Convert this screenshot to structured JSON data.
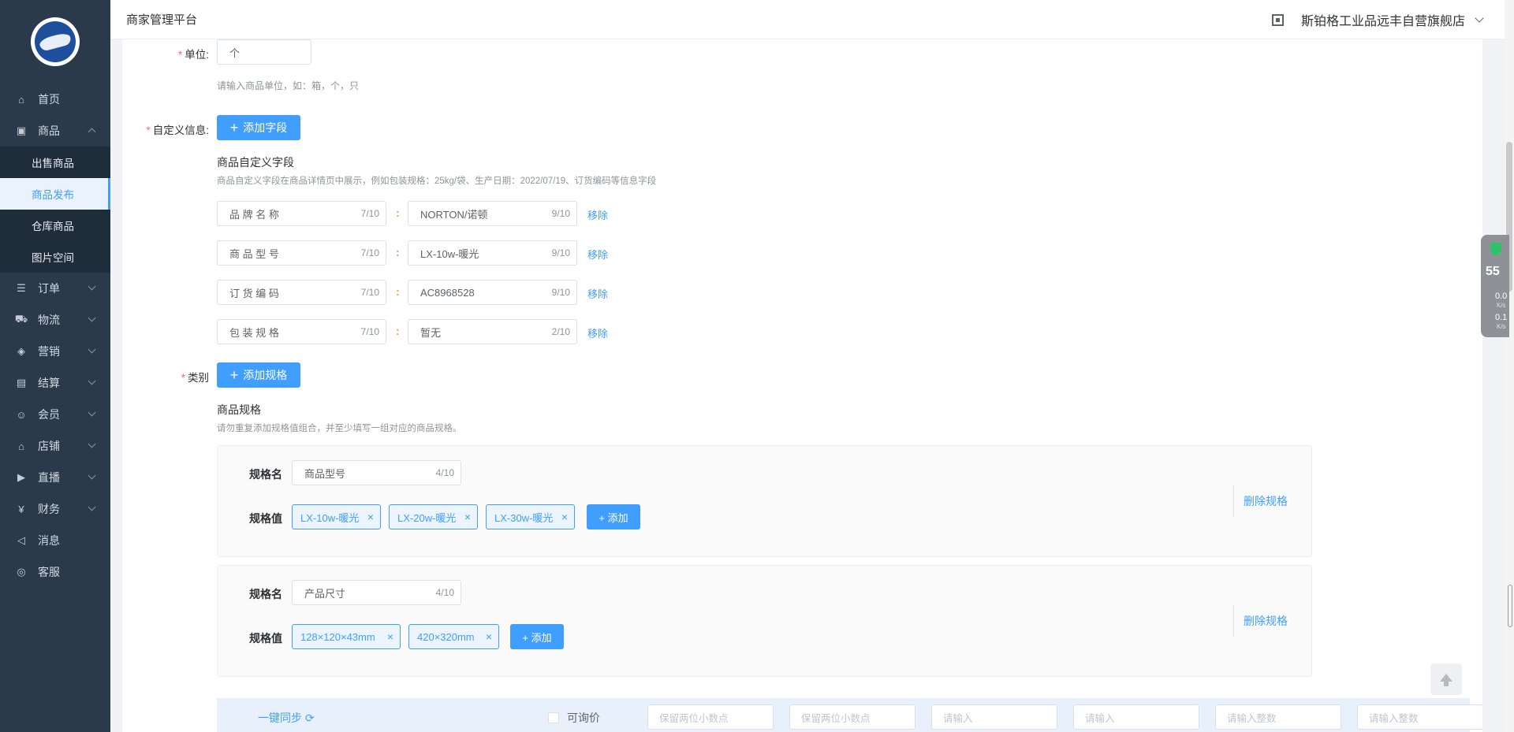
{
  "app": {
    "title": "商家管理平台",
    "shop_name": "斯铂格工业品远丰自营旗舰店"
  },
  "sidebar": {
    "items": [
      {
        "label": "首页",
        "icon": "home-icon"
      },
      {
        "label": "商品",
        "icon": "goods-icon",
        "expanded": true
      },
      {
        "label": "订单",
        "icon": "order-icon"
      },
      {
        "label": "物流",
        "icon": "truck-icon"
      },
      {
        "label": "营销",
        "icon": "tag-icon"
      },
      {
        "label": "结算",
        "icon": "ledger-icon"
      },
      {
        "label": "会员",
        "icon": "user-icon"
      },
      {
        "label": "店铺",
        "icon": "store-icon"
      },
      {
        "label": "直播",
        "icon": "live-icon"
      },
      {
        "label": "财务",
        "icon": "finance-icon"
      },
      {
        "label": "消息",
        "icon": "speaker-icon"
      },
      {
        "label": "客服",
        "icon": "service-icon"
      }
    ],
    "sub_items": [
      {
        "label": "出售商品"
      },
      {
        "label": "商品发布",
        "active": true
      },
      {
        "label": "仓库商品"
      },
      {
        "label": "图片空间"
      }
    ]
  },
  "form": {
    "unit": {
      "label": "单位:",
      "value": "个",
      "hint": "请输入商品单位，如：箱，个，只"
    },
    "custom": {
      "label": "自定义信息:",
      "add_button": "添加字段",
      "section_title": "商品自定义字段",
      "section_hint": "商品自定义字段在商品详情页中展示，例如包装规格：25kg/袋、生产日期：2022/07/19、订货编码等信息字段",
      "fields": [
        {
          "name": "品 牌 名 称",
          "name_count": "7/10",
          "value": "NORTON/诺顿",
          "value_count": "9/10",
          "remove": "移除"
        },
        {
          "name": "商 品 型 号",
          "name_count": "7/10",
          "value": "LX-10w-暖光",
          "value_count": "9/10",
          "remove": "移除"
        },
        {
          "name": "订 货 编 码",
          "name_count": "7/10",
          "value": "AC8968528",
          "value_count": "9/10",
          "remove": "移除"
        },
        {
          "name": "包 装 规 格",
          "name_count": "7/10",
          "value": "暂无",
          "value_count": "2/10",
          "remove": "移除"
        }
      ]
    },
    "category": {
      "label": "类别",
      "add_button": "添加规格",
      "section_title": "商品规格",
      "section_hint": "请勿重复添加规格值组合，并至少填写一组对应的商品规格。",
      "specs": [
        {
          "name_label": "规格名",
          "name": "商品型号",
          "name_count": "4/10",
          "value_label": "规格值",
          "values": [
            "LX-10w-暖光",
            "LX-20w-暖光",
            "LX-30w-暖光"
          ],
          "add_label": "+ 添加",
          "delete_label": "删除规格"
        },
        {
          "name_label": "规格名",
          "name": "产品尺寸",
          "name_count": "4/10",
          "value_label": "规格值",
          "values": [
            "128×120×43mm",
            "420×320mm"
          ],
          "add_label": "+ 添加",
          "delete_label": "删除规格"
        }
      ]
    },
    "sync": {
      "link": "一键同步",
      "checkbox_label": "可询价",
      "placeholders": [
        "保留两位小数点",
        "保留两位小数点",
        "请输入",
        "请输入",
        "请输入整数",
        "请输入整数"
      ]
    }
  },
  "widget": {
    "percent": "55",
    "up": "0.0",
    "down": "0.1",
    "unit": "K/s"
  }
}
